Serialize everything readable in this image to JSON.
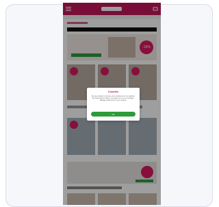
{
  "modal": {
    "title": "Cookies",
    "body": "We use cookies to improve your experience on our website. By continuing to browse, you agree to our use of cookies. Manage preferences in your settings.",
    "accept_label": "OK"
  },
  "banner": {
    "badge_text": "-15%"
  },
  "colors": {
    "brand": "#c2185b",
    "cta": "#2e9c3a",
    "background": "#f5f7fb"
  }
}
